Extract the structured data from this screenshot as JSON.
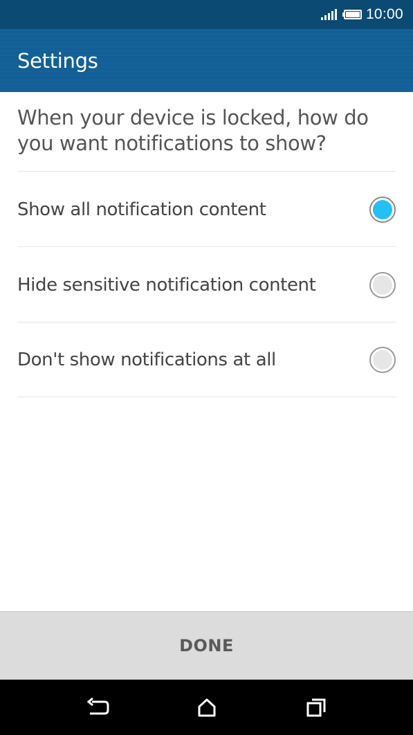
{
  "status_bar": {
    "time": "10:00"
  },
  "app_bar": {
    "title": "Settings"
  },
  "question": "When your device is locked, how do you want notifications to show?",
  "options": [
    {
      "label": "Show all notification content",
      "selected": true
    },
    {
      "label": "Hide sensitive notification content",
      "selected": false
    },
    {
      "label": "Don't show notifications at all",
      "selected": false
    }
  ],
  "done_label": "DONE",
  "colors": {
    "status_bar": "#0b4a73",
    "app_bar": "#14629a",
    "radio_selected": "#22c0f5",
    "radio_unselected": "#e6e6e6",
    "done_bar": "#dcdcdc"
  },
  "icons": {
    "signal": "signal-icon",
    "battery": "battery-icon",
    "back": "back-icon",
    "home": "home-icon",
    "recents": "recents-icon"
  }
}
